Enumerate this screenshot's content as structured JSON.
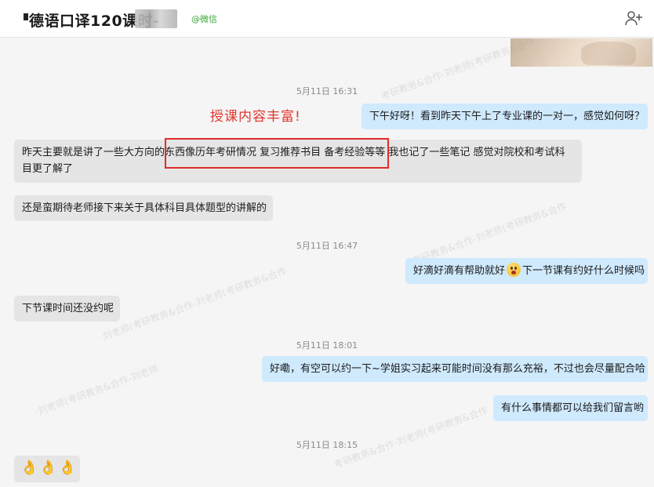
{
  "header": {
    "title": "德语口译120课时-",
    "source": "@微信",
    "add_user_icon": "add-user-icon"
  },
  "annotation": "授课内容丰富!",
  "messages": [
    {
      "time": "5月11日 16:31"
    },
    {
      "side": "out",
      "text": "下午好呀！看到昨天下午上了专业课的一对一，感觉如何呀？"
    },
    {
      "side": "in",
      "text": "昨天主要就是讲了一些大方向的东西像历年考研情况 复习推荐书目 备考经验等等 我也记了一些笔记 感觉对院校和考试科目更了解了"
    },
    {
      "side": "in",
      "text": "还是蛮期待老师接下来关于具体科目具体题型的讲解的"
    },
    {
      "time": "5月11日 16:47"
    },
    {
      "side": "out",
      "text_before": "好滴好滴有帮助就好",
      "emoji": "shocked-face-emoji",
      "text_after": "下一节课有约好什么时候吗"
    },
    {
      "side": "in",
      "text": "下节课时间还没约呢"
    },
    {
      "time": "5月11日 18:01"
    },
    {
      "side": "out",
      "text": "好嘞，有空可以约一下~学姐实习起来可能时间没有那么充裕，不过也会尽量配合哈"
    },
    {
      "side": "out",
      "text": "有什么事情都可以给我们留言哟"
    },
    {
      "time": "5月11日 18:15"
    },
    {
      "side": "in",
      "emoji": "ok-hand-emoji",
      "count": 3
    }
  ],
  "colors": {
    "incoming_bubble": "#e5e5e5",
    "outgoing_bubble": "#cfe9fd",
    "annotation": "#e4362f",
    "source": "#3aa63a"
  }
}
